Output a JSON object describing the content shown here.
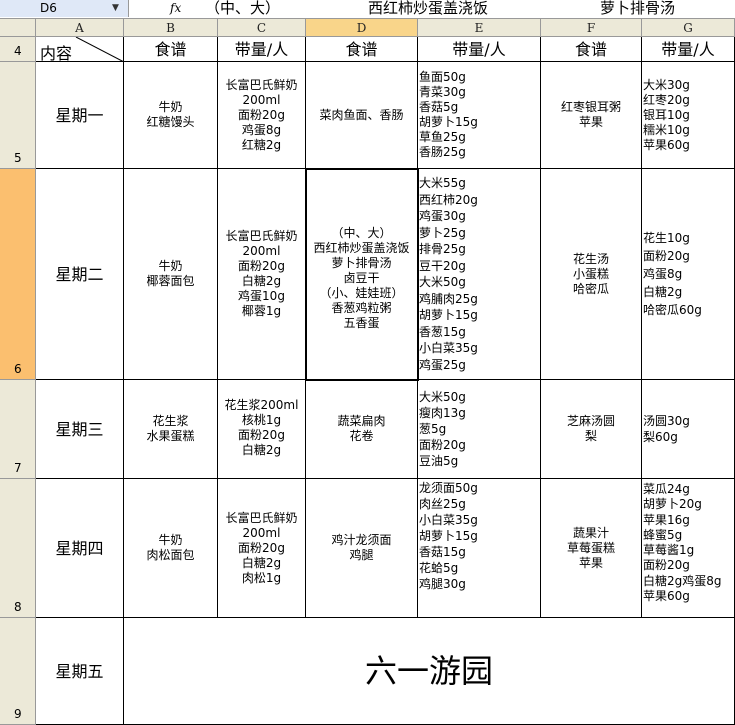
{
  "formula_bar": {
    "name_box": "D6",
    "fx_label": "fx",
    "content_1": "（中、大）",
    "content_2": "西红柿炒蛋盖浇饭",
    "content_3": "萝卜排骨汤"
  },
  "columns": [
    "A",
    "B",
    "C",
    "D",
    "E",
    "F",
    "G"
  ],
  "rows": [
    "4",
    "5",
    "6",
    "7",
    "8",
    "9"
  ],
  "header": {
    "content_label": "内容",
    "recipe": "食谱",
    "amount": "带量/人"
  },
  "days": [
    {
      "day": "星期一",
      "breakfast": "牛奶\n红糖馒头",
      "breakfast_amount": "长富巴氏鲜奶\n200ml\n面粉20g\n鸡蛋8g\n红糖2g",
      "lunch": "菜肉鱼面、香肠",
      "lunch_amount": "鱼面50g\n青菜30g\n香菇5g\n胡萝卜15g\n草鱼25g\n香肠25g",
      "snack": "红枣银耳粥\n苹果",
      "snack_amount": "大米30g\n红枣20g\n银耳10g\n糯米10g\n苹果60g"
    },
    {
      "day": "星期二",
      "breakfast": "牛奶\n椰蓉面包",
      "breakfast_amount": "长富巴氏鲜奶\n200ml\n面粉20g\n白糖2g\n鸡蛋10g\n椰蓉1g",
      "lunch": "（中、大）\n西红柿炒蛋盖浇饭\n萝卜排骨汤\n卤豆干\n（小、娃娃班）\n香葱鸡粒粥\n五香蛋",
      "lunch_amount": "大米55g\n西红柿20g\n鸡蛋30g\n萝卜25g\n排骨25g\n豆干20g\n大米50g\n鸡脯肉25g\n胡萝卜15g\n香葱15g\n小白菜35g\n鸡蛋25g",
      "snack": "花生汤\n小蛋糕\n哈密瓜",
      "snack_amount": "花生10g\n面粉20g\n鸡蛋8g\n白糖2g\n哈密瓜60g"
    },
    {
      "day": "星期三",
      "breakfast": "花生浆\n水果蛋糕",
      "breakfast_amount": "花生浆200ml\n核桃1g\n面粉20g\n白糖2g",
      "lunch": "蔬菜扁肉\n花卷",
      "lunch_amount": "大米50g\n瘦肉13g\n葱5g\n面粉20g\n豆油5g",
      "snack": "芝麻汤圆\n梨",
      "snack_amount": "汤圆30g\n梨60g"
    },
    {
      "day": "星期四",
      "breakfast": "牛奶\n肉松面包",
      "breakfast_amount": "长富巴氏鲜奶\n200ml\n面粉20g\n白糖2g\n肉松1g",
      "lunch": "鸡汁龙须面\n鸡腿",
      "lunch_amount": "龙须面50g\n肉丝25g\n小白菜35g\n胡萝卜15g\n香菇15g\n花蛤5g\n鸡腿30g",
      "snack": "蔬果汁\n草莓蛋糕\n苹果",
      "snack_amount": "菜瓜24g\n胡萝卜20g\n苹果16g\n蜂蜜5g\n草莓酱1g\n面粉20g\n白糖2g鸡蛋8g\n苹果60g"
    },
    {
      "day": "星期五",
      "event": "六一游园"
    }
  ]
}
